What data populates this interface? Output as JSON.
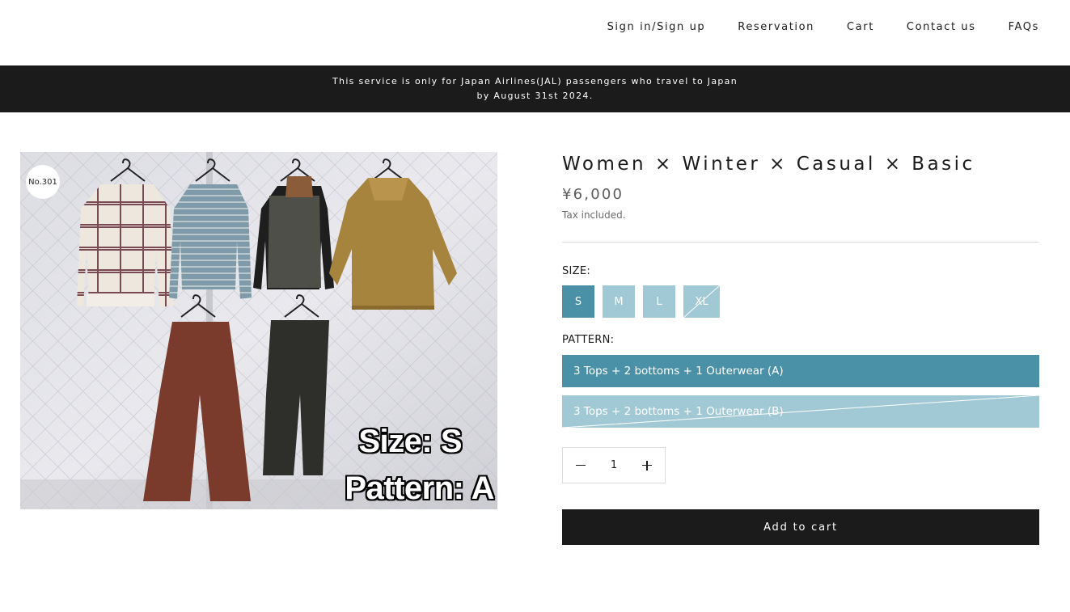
{
  "nav": {
    "items": [
      "Sign in/Sign up",
      "Reservation",
      "Cart",
      "Contact us",
      "FAQs"
    ]
  },
  "announcement": {
    "line1": "This service is only for Japan Airlines(JAL) passengers who travel to Japan",
    "line2": "by August 31st 2024."
  },
  "gallery": {
    "badge": "No.301",
    "size_text": "Size: S",
    "pattern_text": "Pattern: A"
  },
  "product": {
    "title": "Women × Winter × Casual × Basic",
    "price": "¥6,000",
    "tax": "Tax included.",
    "size_label": "SIZE:",
    "sizes": [
      "S",
      "M",
      "L",
      "XL"
    ],
    "pattern_label": "PATTERN:",
    "patterns": [
      "3 Tops + 2 bottoms + 1 Outerwear (A)",
      "3 Tops + 2 bottoms + 1 Outerwear (B)"
    ],
    "quantity": "1",
    "add_to_cart": "Add to cart"
  },
  "colors": {
    "accent": "#4a91a8",
    "accent_light": "#a1c9d5",
    "dark": "#1c1b1b"
  }
}
